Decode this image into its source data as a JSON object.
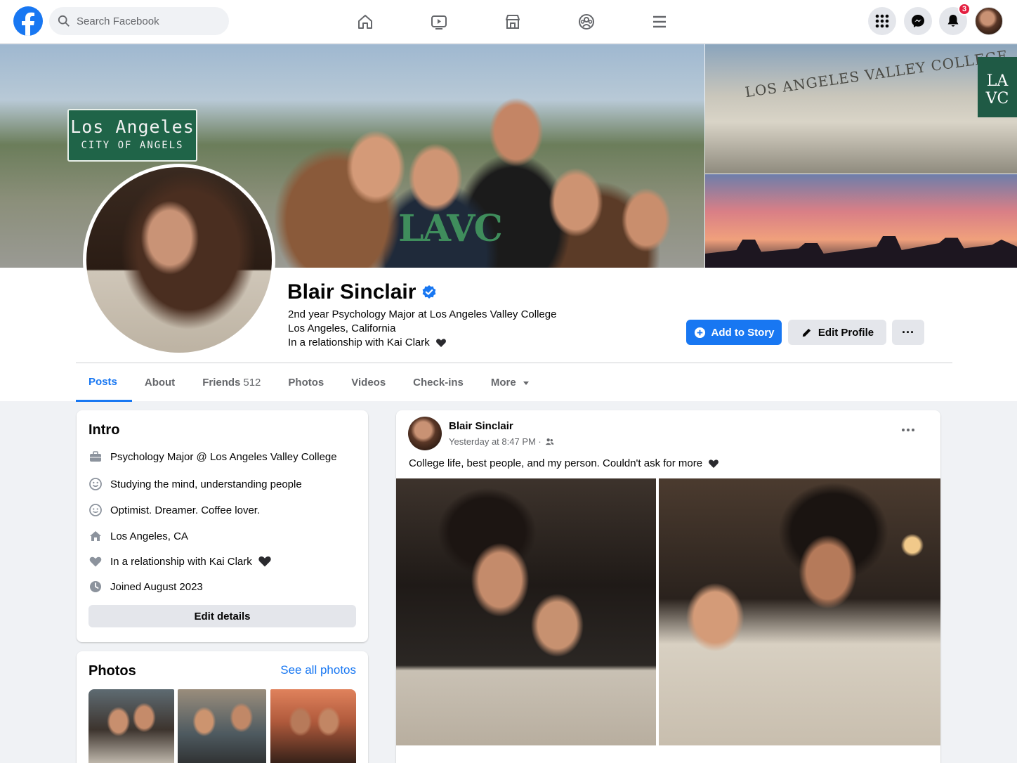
{
  "header": {
    "search_placeholder": "Search Facebook",
    "notification_count": "3",
    "nav_icons": [
      "home-icon",
      "watch-icon",
      "marketplace-icon",
      "groups-icon",
      "menu-icon"
    ],
    "right_icons": [
      "apps-grid-icon",
      "messenger-icon",
      "notifications-bell-icon"
    ]
  },
  "cover": {
    "sign_line1": "Los Angeles",
    "sign_line2": "CITY OF ANGELS",
    "college_sign": "LOS ANGELES VALLEY COLLEGE",
    "logo_text": "LA VC",
    "shirt_text": "LAVC"
  },
  "profile": {
    "name": "Blair Sinclair",
    "verified": true,
    "line1": "2nd year Psychology Major at Los Angeles Valley College",
    "line2": "Los Angeles, California",
    "line3": "In a relationship with Kai Clark",
    "add_story": "Add to Story",
    "edit_profile": "Edit Profile",
    "more": "···"
  },
  "tabs": [
    {
      "label": "Posts",
      "active": true
    },
    {
      "label": "About"
    },
    {
      "label": "Friends",
      "count": "512"
    },
    {
      "label": "Photos"
    },
    {
      "label": "Videos"
    },
    {
      "label": "Check-ins"
    },
    {
      "label": "More"
    }
  ],
  "intro": {
    "title": "Intro",
    "items": [
      {
        "icon": "briefcase-icon",
        "text": "Psychology Major @ Los Angeles Valley College"
      },
      {
        "icon": "smile-icon",
        "text": "Studying the mind, understanding people"
      },
      {
        "icon": "smile-outline-icon",
        "text": "Optimist. Dreamer. Coffee lover."
      },
      {
        "icon": "home-icon",
        "text": "Los Angeles, CA"
      },
      {
        "icon": "heart-icon",
        "text": "In a relationship with Kai Clark"
      },
      {
        "icon": "clock-icon",
        "text": "Joined August 2023"
      }
    ],
    "edit_details": "Edit details"
  },
  "photos_card": {
    "title": "Photos",
    "see_all": "See all photos"
  },
  "post": {
    "author": "Blair Sinclair",
    "time": "Yesterday at 8:47 PM ·",
    "audience_icon": "friends-icon",
    "text": "College life, best people, and my person. Couldn't ask for more"
  },
  "colors": {
    "brand": "#1877f2",
    "badge": "#e41e3f",
    "background": "#f0f2f5"
  }
}
